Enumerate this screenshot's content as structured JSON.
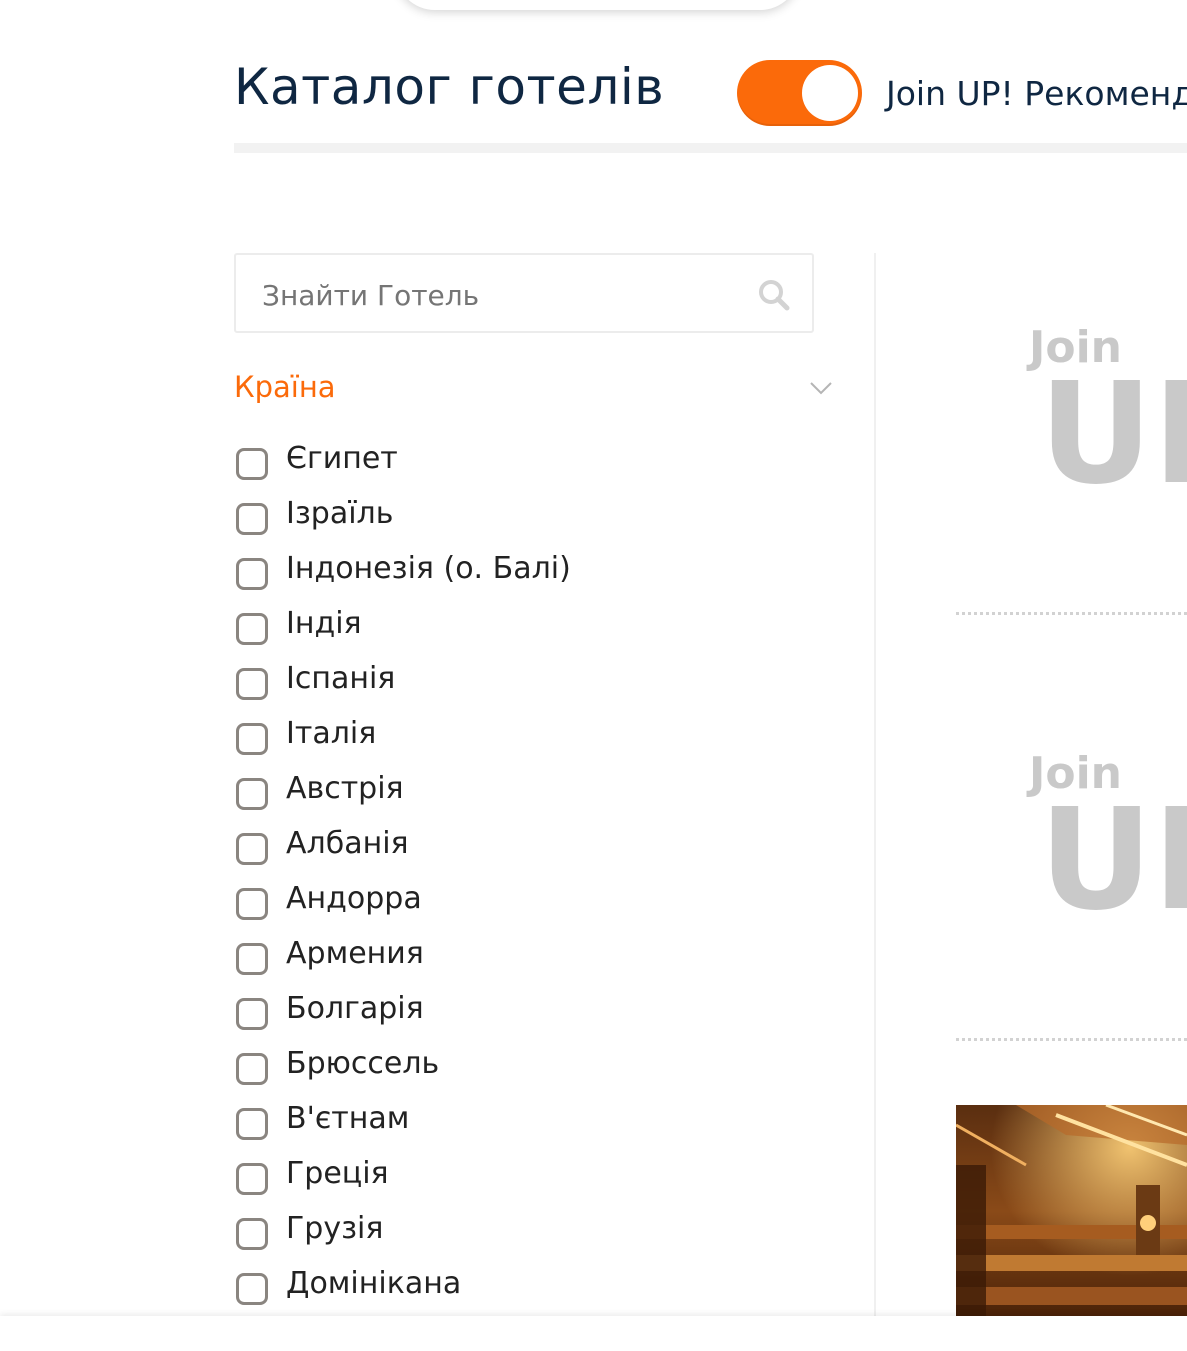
{
  "header": {
    "title": "Каталог готелів",
    "toggle_label": "Join UP! Рекоменд",
    "toggle_on": true
  },
  "search": {
    "placeholder": "Знайти Готель"
  },
  "filter": {
    "title": "Країна",
    "countries": [
      "Єгипет",
      "Ізраїль",
      "Індонезія (о. Балі)",
      "Індія",
      "Іспанія",
      "Італія",
      "Австрія",
      "Албанія",
      "Андорра",
      "Армения",
      "Болгарія",
      "Брюссель",
      "В'єтнам",
      "Греція",
      "Грузія",
      "Домінікана"
    ]
  },
  "cards": {
    "logo_text_top": "Join",
    "logo_text_bottom": "UP"
  },
  "colors": {
    "accent": "#fb6a0a",
    "title": "#0f2742",
    "logo_gray": "#c9c9c9"
  }
}
